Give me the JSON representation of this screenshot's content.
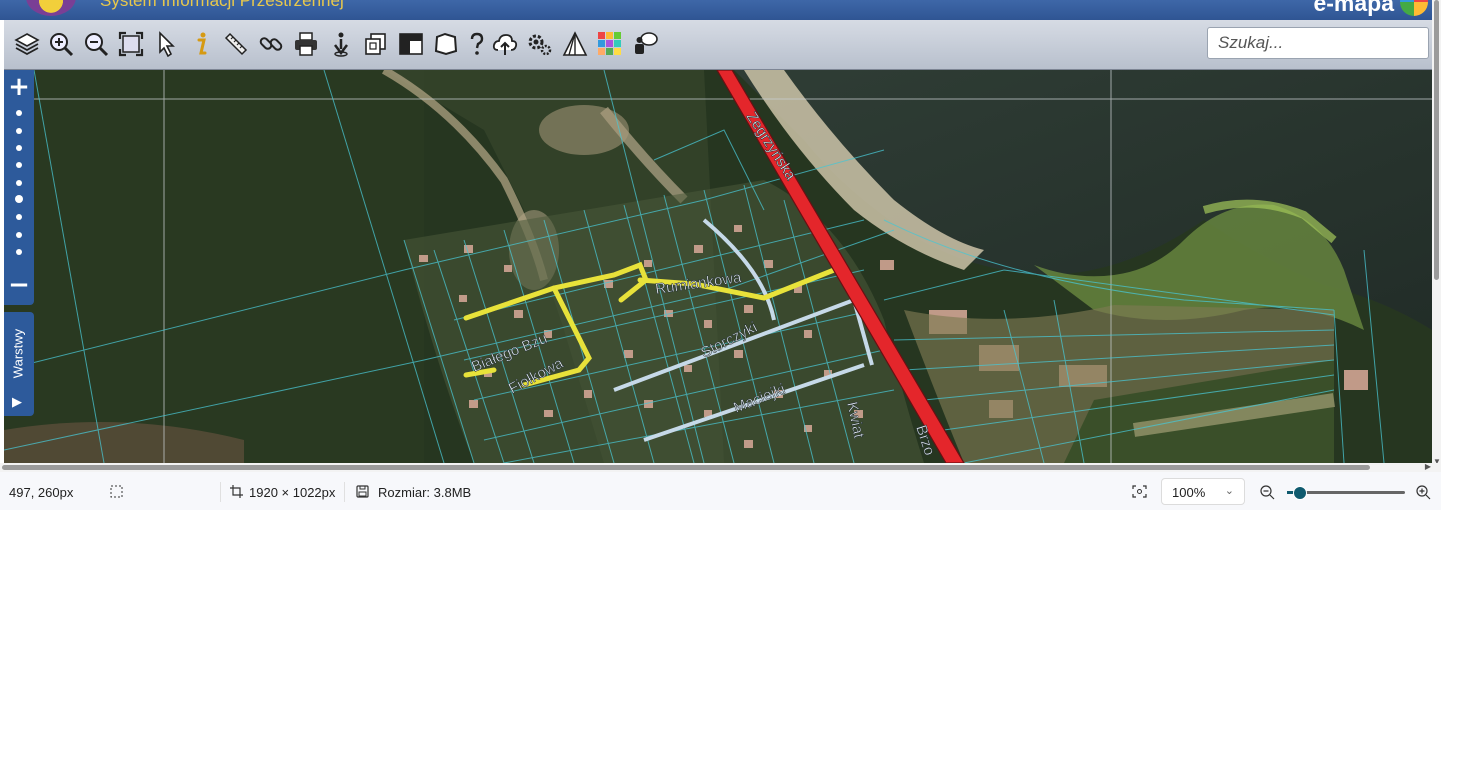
{
  "header": {
    "system_title": "System Informacji Przestrzennej",
    "brand": "e-mapa"
  },
  "toolbar": {
    "tools": [
      {
        "name": "layers-icon"
      },
      {
        "name": "zoom-in-icon"
      },
      {
        "name": "zoom-out-icon"
      },
      {
        "name": "full-extent-icon"
      },
      {
        "name": "select-arrow-icon"
      },
      {
        "name": "info-icon"
      },
      {
        "name": "measure-ruler-icon"
      },
      {
        "name": "link-icon"
      },
      {
        "name": "print-icon"
      },
      {
        "name": "identify-pin-icon"
      },
      {
        "name": "copy-icon"
      },
      {
        "name": "layout-icon"
      },
      {
        "name": "area-icon"
      },
      {
        "name": "help-icon"
      },
      {
        "name": "cloud-upload-icon"
      },
      {
        "name": "settings-gears-icon"
      },
      {
        "name": "triangle-icon"
      },
      {
        "name": "color-grid-icon"
      },
      {
        "name": "chat-icon"
      }
    ],
    "search_placeholder": "Szukaj..."
  },
  "map": {
    "street_labels": [
      "Zegrzyńska",
      "Rumiankowa",
      "Białego Bzu",
      "Fiołkowa",
      "Storczyki",
      "Maciejki",
      "Kwiat",
      "Brzo"
    ],
    "zoom_plus": "+",
    "zoom_minus": "−",
    "layers_tab_label": "Warstwy",
    "colors": {
      "main_road": "#e4262b",
      "highlight_streets": "#e8e23a",
      "side_streets": "#c6d9e8",
      "parcels": "#49c6d3"
    }
  },
  "status_bar": {
    "cursor_position": "497, 260px",
    "image_dimensions": "1920 × 1022px",
    "file_size": "Rozmiar: 3.8MB",
    "zoom_value": "100%",
    "zoom_level": 0.1
  }
}
